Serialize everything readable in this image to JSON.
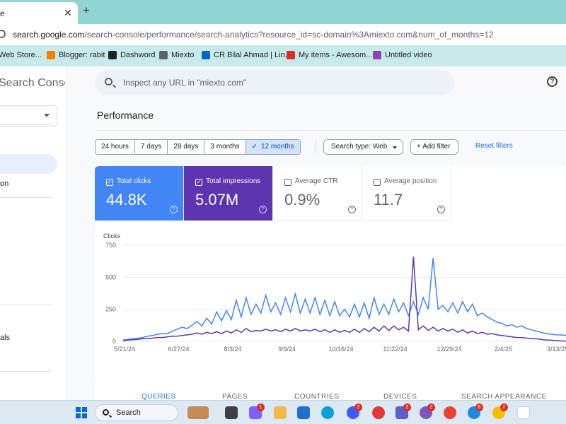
{
  "browser": {
    "tab_title": "e",
    "tab_close": "✕",
    "new_tab": "+",
    "url_host": "search.google.com",
    "url_rest": "/search-console/performance/search-analytics?resource_id=sc-domain%3Amiexto.com&num_of_months=12",
    "bookmarks": [
      {
        "label": "Web Store...",
        "icon": "web-store-icon",
        "color": "#4285f4"
      },
      {
        "label": "Blogger: rabit",
        "icon": "blogger-icon",
        "color": "#f57d00"
      },
      {
        "label": "Dashword",
        "icon": "dashword-icon",
        "color": "#202124"
      },
      {
        "label": "Miexto",
        "icon": "folder-icon",
        "color": "#5f6368"
      },
      {
        "label": "CR Bilal Ahmad | Lin...",
        "icon": "linkedin-icon",
        "color": "#0a66c2"
      },
      {
        "label": "My items - Awesom...",
        "icon": "awesome-icon",
        "color": "#d93025"
      },
      {
        "label": "Untitled video",
        "icon": "video-icon",
        "color": "#8e44ad"
      }
    ]
  },
  "sidebar": {
    "brand": "Search Console",
    "items": [
      {
        "label": "on"
      },
      {
        "label": "als"
      }
    ]
  },
  "search": {
    "placeholder": "Inspect any URL in \"miexto.com\""
  },
  "page": {
    "title": "Performance"
  },
  "filters": {
    "ranges": [
      "24 hours",
      "7 days",
      "28 days",
      "3 months",
      "12 months"
    ],
    "active_range": "12 months",
    "check_glyph": "✓",
    "search_type": "Search type: Web",
    "add_filter": "+   Add filter",
    "reset": "Reset filters"
  },
  "metrics": [
    {
      "label": "Total clicks",
      "value": "44.8K",
      "selected": true,
      "color": "#4285f4"
    },
    {
      "label": "Total impressions",
      "value": "5.07M",
      "selected": true,
      "color": "#5e35b1"
    },
    {
      "label": "Average CTR",
      "value": "0.9%",
      "selected": false,
      "color": "#ffffff"
    },
    {
      "label": "Average position",
      "value": "11.7",
      "selected": false,
      "color": "#ffffff"
    }
  ],
  "colors": {
    "clicks": "#4285f4",
    "impressions": "#5e35b1",
    "link": "#1a73e8"
  },
  "chart_data": {
    "type": "line",
    "ylabel": "Clicks",
    "ylim": [
      0,
      750
    ],
    "yticks": [
      0,
      250,
      500,
      750
    ],
    "x_ticks": [
      "5/21/24",
      "6/27/24",
      "8/3/24",
      "9/9/24",
      "10/16/24",
      "11/22/24",
      "12/29/24",
      "2/4/25",
      "3/13/25"
    ],
    "grid": true,
    "series": [
      {
        "color": "#4285f4",
        "values": [
          10,
          15,
          20,
          25,
          30,
          40,
          45,
          55,
          60,
          60,
          80,
          95,
          110,
          100,
          125,
          155,
          120,
          180,
          135,
          230,
          160,
          240,
          170,
          320,
          190,
          340,
          210,
          290,
          220,
          360,
          230,
          300,
          210,
          340,
          230,
          370,
          220,
          330,
          220,
          340,
          210,
          320,
          200,
          310,
          200,
          250,
          190,
          290,
          190,
          300,
          180,
          340,
          210,
          290,
          210,
          330,
          230,
          300,
          200,
          310,
          210,
          340,
          250,
          650,
          250,
          280,
          230,
          300,
          220,
          310,
          230,
          290,
          200,
          220,
          190,
          170,
          150,
          140,
          120,
          130,
          110,
          120,
          100,
          90,
          80,
          70,
          60,
          55,
          50,
          50,
          45
        ]
      },
      {
        "color": "#5e35b1",
        "values": [
          5,
          10,
          12,
          15,
          20,
          20,
          25,
          30,
          30,
          35,
          40,
          40,
          45,
          50,
          55,
          65,
          55,
          70,
          60,
          75,
          60,
          80,
          65,
          90,
          70,
          100,
          75,
          85,
          80,
          95,
          80,
          90,
          75,
          95,
          80,
          100,
          80,
          90,
          80,
          95,
          75,
          90,
          70,
          90,
          70,
          85,
          70,
          95,
          70,
          100,
          75,
          110,
          80,
          120,
          85,
          120,
          90,
          110,
          80,
          660,
          90,
          120,
          85,
          110,
          80,
          100,
          80,
          95,
          70,
          90,
          65,
          80,
          60,
          70,
          55,
          60,
          50,
          45,
          40,
          35,
          30,
          30,
          25,
          20,
          20,
          15,
          10,
          10,
          5,
          5,
          0
        ]
      }
    ]
  },
  "bottom_tabs": [
    "QUERIES",
    "PAGES",
    "COUNTRIES",
    "DEVICES",
    "SEARCH APPEARANCE"
  ],
  "taskbar": {
    "search": "Search",
    "badges": [
      "1",
      "2",
      "2",
      "2",
      "8",
      "2"
    ]
  }
}
